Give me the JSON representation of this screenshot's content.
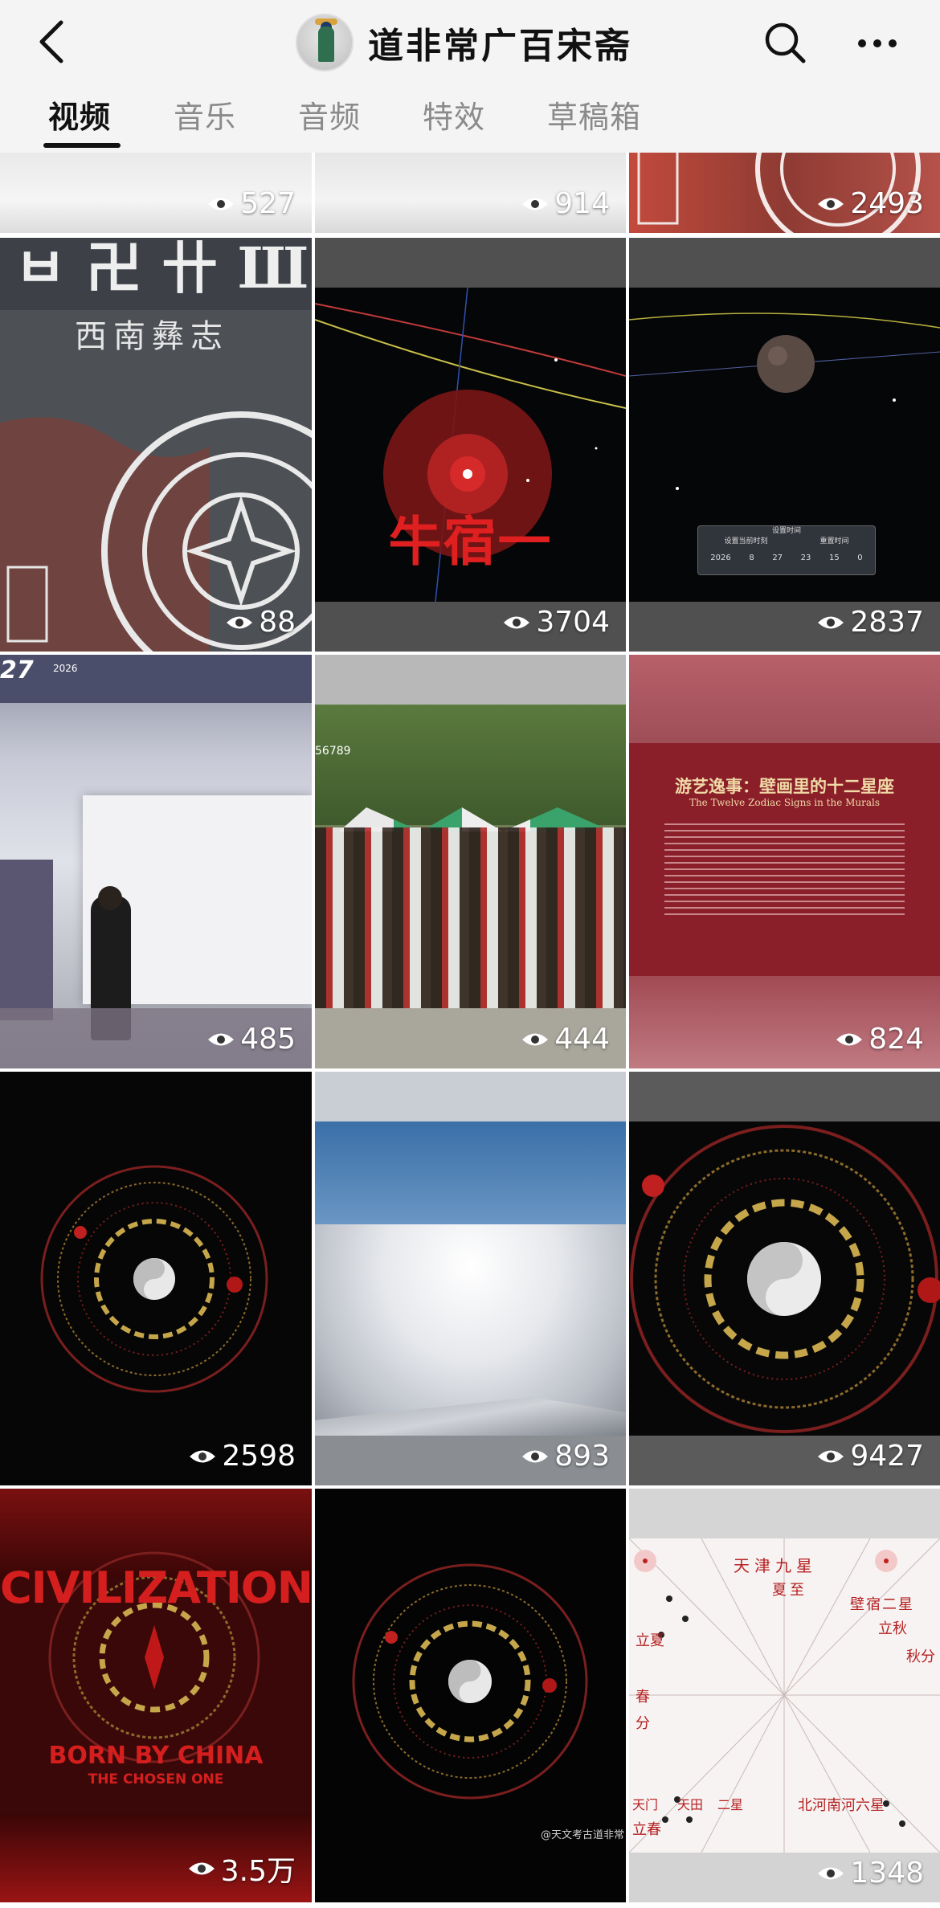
{
  "header": {
    "back_icon": "chevron-left-icon",
    "title": "道非常广百宋斋",
    "search_icon": "search-icon",
    "more_icon": "ellipsis-icon"
  },
  "tabs": [
    {
      "label": "视频",
      "active": true
    },
    {
      "label": "音乐",
      "active": false
    },
    {
      "label": "音频",
      "active": false
    },
    {
      "label": "特效",
      "active": false
    },
    {
      "label": "草稿箱",
      "active": false
    }
  ],
  "videos": [
    {
      "views": "527"
    },
    {
      "views": "914"
    },
    {
      "views": "2493"
    },
    {
      "views": "88",
      "caption": "西南彝志"
    },
    {
      "views": "3704",
      "caption": "牛宿一"
    },
    {
      "views": "2837",
      "dialog": {
        "title": "设置时间",
        "label1": "设置当前时刻",
        "label2": "重置时间",
        "year": "2026",
        "month": "8",
        "day": "27",
        "hour": "23",
        "minute": "15",
        "second": "0"
      }
    },
    {
      "views": "485",
      "date_day": "27",
      "date_year": "2026"
    },
    {
      "views": "444",
      "corner_text": "56789"
    },
    {
      "views": "824",
      "title_cn": "游艺逸事：壁画里的十二星座",
      "title_en": "The Twelve Zodiac Signs in the Murals"
    },
    {
      "views": "2598"
    },
    {
      "views": "893"
    },
    {
      "views": "9427"
    },
    {
      "views": "3.5万",
      "line1": "CIVILIZATION",
      "line2": "BORN BY CHINA",
      "line3": "THE CHOSEN ONE"
    },
    {
      "views": "",
      "watermark": "@天文考古道非常"
    },
    {
      "views": "1348",
      "labels": [
        "天津九星",
        "夏至",
        "壁宿二星",
        "立秋",
        "秋分",
        "北河南河六星",
        "立夏",
        "春",
        "分",
        "天门",
        "天田",
        "二星",
        "立春"
      ]
    }
  ],
  "colors": {
    "header_bg": "#f4f4f4",
    "tab_active": "#111111",
    "tab_inactive": "#8a8a8a"
  }
}
